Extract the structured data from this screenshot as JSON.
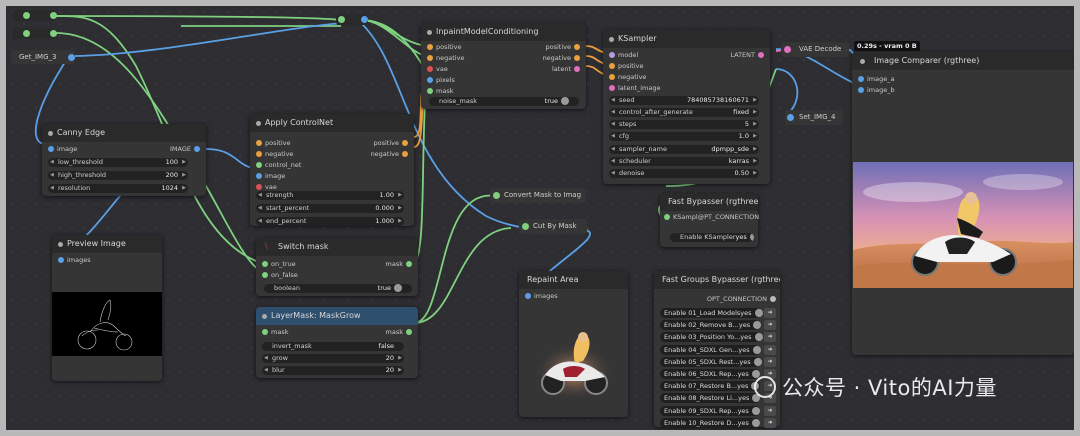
{
  "nodes": {
    "get_img": {
      "title": "Get_IMG_3"
    },
    "canny": {
      "title": "Canny Edge",
      "input_image": "image",
      "output_image": "IMAGE",
      "widgets": [
        {
          "label": "low_threshold",
          "value": "100"
        },
        {
          "label": "high_threshold",
          "value": "200"
        },
        {
          "label": "resolution",
          "value": "1024"
        }
      ]
    },
    "preview": {
      "title": "Preview Image",
      "input_images": "images"
    },
    "controlnet": {
      "title": "Apply ControlNet",
      "inputs": [
        "positive",
        "negative",
        "control_net",
        "image",
        "vae"
      ],
      "outputs": [
        "positive",
        "negative"
      ],
      "widgets": [
        {
          "label": "strength",
          "value": "1.00"
        },
        {
          "label": "start_percent",
          "value": "0.000"
        },
        {
          "label": "end_percent",
          "value": "1.000"
        }
      ]
    },
    "switch": {
      "title": "Switch mask",
      "inputs": [
        "on_true",
        "on_false"
      ],
      "output": "mask",
      "widget_label": "boolean",
      "widget_value": "true"
    },
    "grow": {
      "title": "LayerMask: MaskGrow",
      "input": "mask",
      "output": "mask",
      "widgets": [
        {
          "label": "invert_mask",
          "value": "false"
        },
        {
          "label": "grow",
          "value": "20"
        },
        {
          "label": "blur",
          "value": "20"
        }
      ]
    },
    "inpaint": {
      "title": "InpaintModelConditioning",
      "inputs": [
        "positive",
        "negative",
        "vae",
        "pixels",
        "mask"
      ],
      "outputs": [
        "positive",
        "negative",
        "latent"
      ],
      "widget_label": "noise_mask",
      "widget_value": "true"
    },
    "convert": {
      "title": "Convert Mask to Imag"
    },
    "cut": {
      "title": "Cut By Mask"
    },
    "repaint": {
      "title": "Repaint Area",
      "input": "images"
    },
    "ksampler": {
      "title": "KSampler",
      "inputs": [
        "model",
        "positive",
        "negative",
        "latent_image"
      ],
      "output": "LATENT",
      "widgets": [
        {
          "label": "seed",
          "value": "784085738160671"
        },
        {
          "label": "control_after_generate",
          "value": "fixed"
        },
        {
          "label": "steps",
          "value": "5"
        },
        {
          "label": "cfg",
          "value": "1.0"
        },
        {
          "label": "sampler_name",
          "value": "dpmpp_sde"
        },
        {
          "label": "scheduler",
          "value": "karras"
        },
        {
          "label": "denoise",
          "value": "0.50"
        }
      ]
    },
    "fast_bypasser": {
      "title": "Fast Bypasser (rgthree)",
      "input": "KSampl@PT_CONNECTION",
      "toggle_label": "Enable KSampler",
      "toggle_value": "yes"
    },
    "fast_groups": {
      "title": "Fast Groups Bypasser (rgthree)",
      "output": "OPT_CONNECTION",
      "rows": [
        {
          "label": "Enable 01_Load Models",
          "value": "yes"
        },
        {
          "label": "Enable 02_Remove B...",
          "value": "yes"
        },
        {
          "label": "Enable 03_Position Yo...",
          "value": "yes"
        },
        {
          "label": "Enable 04_SDXL Gen...",
          "value": "yes"
        },
        {
          "label": "Enable 05_SDXL Rest...",
          "value": "yes"
        },
        {
          "label": "Enable 06_SDXL Rep...",
          "value": "yes"
        },
        {
          "label": "Enable 07_Restore B...",
          "value": "yes"
        },
        {
          "label": "Enable 08_Restore Li...",
          "value": "yes"
        },
        {
          "label": "Enable 09_SDXL Rep...",
          "value": "yes"
        },
        {
          "label": "Enable 10_Restore D...",
          "value": "yes"
        }
      ]
    },
    "vae_decode": {
      "title": "VAE Decode"
    },
    "set_img": {
      "title": "Set_IMG_4"
    },
    "comparer": {
      "title": "Image Comparer (rgthree)",
      "inputs": [
        "image_a",
        "image_b"
      ],
      "badge": "0.29s - vram 0 B"
    }
  },
  "watermark": "公众号 · Vito的AI力量",
  "colors": {
    "canvas": "#2d2d32",
    "node": "#353535",
    "wire_green": "#7fd17f",
    "wire_blue": "#5aa0e6",
    "wire_orange": "#e8a040",
    "wire_pink": "#e070c0"
  }
}
